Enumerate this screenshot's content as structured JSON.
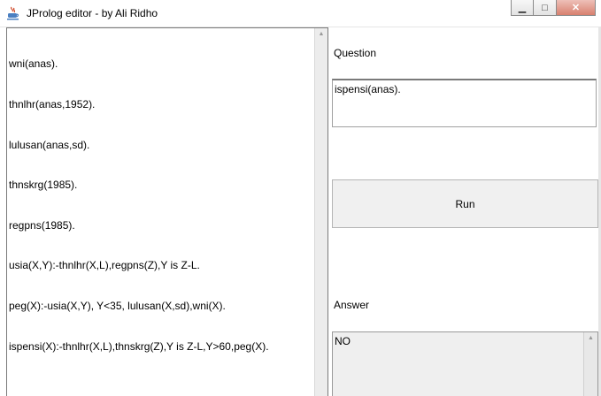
{
  "window": {
    "title": "JProlog editor - by Ali Ridho",
    "minimize_glyph": "▁",
    "maximize_glyph": "□",
    "close_glyph": "✕"
  },
  "editor": {
    "lines": [
      "wni(anas).",
      "thnlhr(anas,1952).",
      "lulusan(anas,sd).",
      "thnskrg(1985).",
      "regpns(1985).",
      "usia(X,Y):-thnlhr(X,L),regpns(Z),Y is Z-L.",
      "peg(X):-usia(X,Y), Y<35, lulusan(X,sd),wni(X).",
      "ispensi(X):-thnlhr(X,L),thnskrg(Z),Y is Z-L,Y>60,peg(X)."
    ]
  },
  "question": {
    "label": "Question",
    "value": "ispensi(anas)."
  },
  "run_button": {
    "label": "Run"
  },
  "answer": {
    "label": "Answer",
    "value": "NO"
  },
  "icons": {
    "title": "java-cup-icon",
    "scroll_up": "scroll-up-arrow-icon"
  }
}
